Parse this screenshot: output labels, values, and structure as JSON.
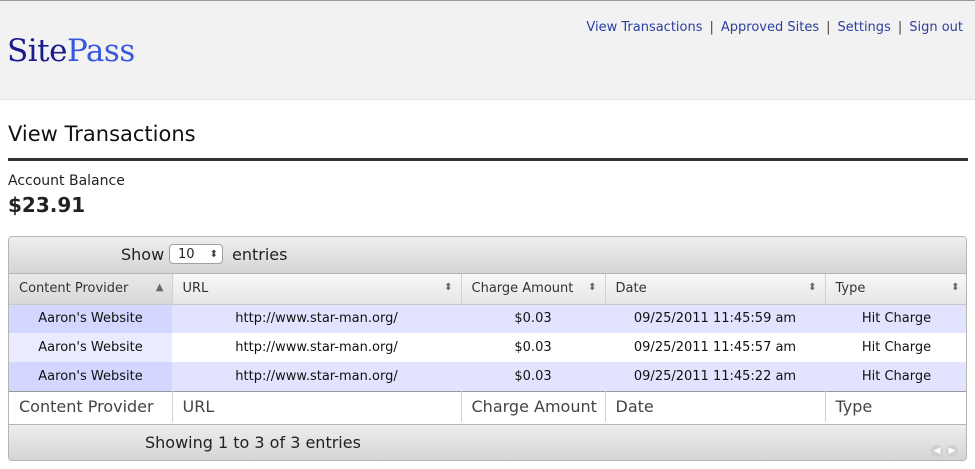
{
  "header": {
    "logo_site": "Site",
    "logo_pass": "Pass",
    "nav": {
      "view_transactions": "View Transactions",
      "approved_sites": "Approved Sites",
      "settings": "Settings",
      "sign_out": "Sign out",
      "separator": "|"
    }
  },
  "page": {
    "title": "View Transactions",
    "balance_label": "Account Balance",
    "balance_value": "$23.91"
  },
  "table": {
    "show_label": "Show",
    "page_size": "10",
    "entries_label": "entries",
    "columns": [
      "Content Provider",
      "URL",
      "Charge Amount",
      "Date",
      "Type"
    ],
    "rows": [
      [
        "Aaron's Website",
        "http://www.star-man.org/",
        "$0.03",
        "09/25/2011 11:45:59 am",
        "Hit Charge"
      ],
      [
        "Aaron's Website",
        "http://www.star-man.org/",
        "$0.03",
        "09/25/2011 11:45:57 am",
        "Hit Charge"
      ],
      [
        "Aaron's Website",
        "http://www.star-man.org/",
        "$0.03",
        "09/25/2011 11:45:22 am",
        "Hit Charge"
      ]
    ],
    "info": "Showing 1 to 3 of 3 entries"
  },
  "colors": {
    "logo_site": "#1a1a8c",
    "logo_pass": "#3a57e0",
    "row_highlight": "#e2e4ff"
  }
}
